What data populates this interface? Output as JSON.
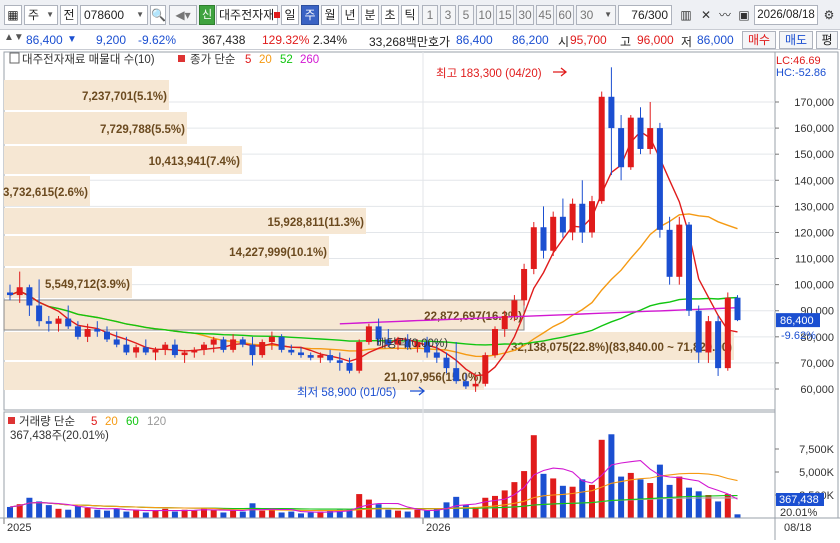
{
  "toolbar": {
    "market": "주",
    "prev_label": "전",
    "code": "078600",
    "sound_icon": "speaker-icon",
    "new_badge": "신",
    "stock_name": "대주전자재",
    "periods": [
      "일",
      "주",
      "월",
      "년",
      "분",
      "초",
      "틱"
    ],
    "selected_period": "주",
    "intervals": [
      "1",
      "3",
      "5",
      "10",
      "15",
      "30",
      "45",
      "60"
    ],
    "interval_value": "30",
    "count": "76",
    "count_total": "/300",
    "date": "2026/08/18"
  },
  "info": {
    "price": "86,400",
    "change": "9,200",
    "change_pct": "-9.62%",
    "volume": "367,438",
    "volume_pct": "129.32%",
    "turnover": "2.34%",
    "amount": "33,268백만",
    "quote_label": "호가",
    "ask": "86,400",
    "bid": "86,200",
    "open_label": "시",
    "open": "95,700",
    "high_label": "고",
    "high": "96,000",
    "low_label": "저",
    "low": "86,000",
    "buy": "매수",
    "sell": "매도",
    "flat": "평"
  },
  "legend": {
    "name": "대주전자재료 매물대 수(10)",
    "ma_label": "종가 단순",
    "ma": [
      "5",
      "20",
      "52",
      "260"
    ],
    "ma_colors": [
      "#e01b1b",
      "#f59a13",
      "#11c511",
      "#d218d2"
    ]
  },
  "volume_legend": {
    "label": "거래량 단순",
    "ma": [
      "5",
      "20",
      "60",
      "120"
    ],
    "value": "367,438주(20.01%)"
  },
  "chart_data": {
    "type": "candlestick",
    "y_axis": {
      "min": 50000,
      "max": 180000,
      "ticks": [
        "60,000",
        "70,000",
        "80,000",
        "90,000",
        "100,000",
        "110,000",
        "120,000",
        "130,000",
        "140,000",
        "150,000",
        "160,000",
        "170,000"
      ],
      "tick_values": [
        60000,
        70000,
        80000,
        90000,
        100000,
        110000,
        120000,
        130000,
        140000,
        150000,
        160000,
        170000
      ]
    },
    "current_price_tag": "86,400",
    "current_pct_tag": "-9.62%",
    "lc": "LC:46.69",
    "hc": "HC:-52.86",
    "x_labels": [
      "2025",
      "2026",
      "08/18"
    ],
    "high_annotation": "최고 183,300 (04/20)",
    "low_annotation": "최저 58,900 (01/05)",
    "volume_profile": [
      {
        "label": "7,237,701(5.1%)"
      },
      {
        "label": "7,729,788(5.5%)"
      },
      {
        "label": "10,413,941(7.4%)"
      },
      {
        "label": "3,732,615(2.6%)"
      },
      {
        "label": "15,928,811(11.3%)"
      },
      {
        "label": "14,227,999(10.1%)"
      },
      {
        "label": "5,549,712(3.9%)"
      },
      {
        "label": "22,872,697(16.2%)"
      },
      {
        "label": "32,138,075(22.8%)(83,840.00 ~ 71,820.00)"
      },
      {
        "label": "21,107,956(15.0%)"
      }
    ],
    "dividend_label": "배당락(0.00%)",
    "candles": [
      {
        "o": 97000,
        "h": 100000,
        "l": 94000,
        "c": 96000
      },
      {
        "o": 96000,
        "h": 105000,
        "l": 93000,
        "c": 99000
      },
      {
        "o": 99000,
        "h": 100000,
        "l": 88000,
        "c": 92000
      },
      {
        "o": 92000,
        "h": 102000,
        "l": 84000,
        "c": 86000
      },
      {
        "o": 86000,
        "h": 88000,
        "l": 82000,
        "c": 85000
      },
      {
        "o": 85000,
        "h": 88000,
        "l": 82000,
        "c": 87000
      },
      {
        "o": 87000,
        "h": 92000,
        "l": 83000,
        "c": 84000
      },
      {
        "o": 84000,
        "h": 86000,
        "l": 79000,
        "c": 80000
      },
      {
        "o": 80000,
        "h": 85000,
        "l": 78000,
        "c": 83000
      },
      {
        "o": 83000,
        "h": 86000,
        "l": 80000,
        "c": 82000
      },
      {
        "o": 82000,
        "h": 84000,
        "l": 78000,
        "c": 79000
      },
      {
        "o": 79000,
        "h": 82000,
        "l": 76000,
        "c": 77000
      },
      {
        "o": 77000,
        "h": 80000,
        "l": 73000,
        "c": 74000
      },
      {
        "o": 74000,
        "h": 77000,
        "l": 72000,
        "c": 76000
      },
      {
        "o": 76000,
        "h": 79000,
        "l": 73000,
        "c": 74000
      },
      {
        "o": 74000,
        "h": 76000,
        "l": 71000,
        "c": 75000
      },
      {
        "o": 75000,
        "h": 78000,
        "l": 73000,
        "c": 77000
      },
      {
        "o": 77000,
        "h": 79000,
        "l": 72000,
        "c": 73000
      },
      {
        "o": 73000,
        "h": 75000,
        "l": 70000,
        "c": 74000
      },
      {
        "o": 74000,
        "h": 76000,
        "l": 72000,
        "c": 75000
      },
      {
        "o": 75000,
        "h": 78000,
        "l": 73000,
        "c": 77000
      },
      {
        "o": 77000,
        "h": 80000,
        "l": 74000,
        "c": 79000
      },
      {
        "o": 79000,
        "h": 80000,
        "l": 74000,
        "c": 75000
      },
      {
        "o": 75000,
        "h": 81000,
        "l": 74000,
        "c": 79000
      },
      {
        "o": 79000,
        "h": 80000,
        "l": 76000,
        "c": 77000
      },
      {
        "o": 77000,
        "h": 80000,
        "l": 69000,
        "c": 73000
      },
      {
        "o": 73000,
        "h": 79000,
        "l": 72000,
        "c": 78000
      },
      {
        "o": 78000,
        "h": 82000,
        "l": 75000,
        "c": 80000
      },
      {
        "o": 80000,
        "h": 81000,
        "l": 74000,
        "c": 75000
      },
      {
        "o": 75000,
        "h": 77000,
        "l": 73000,
        "c": 74000
      },
      {
        "o": 74000,
        "h": 76000,
        "l": 72000,
        "c": 73000
      },
      {
        "o": 73000,
        "h": 74000,
        "l": 71000,
        "c": 72000
      },
      {
        "o": 72000,
        "h": 74000,
        "l": 70000,
        "c": 73000
      },
      {
        "o": 73000,
        "h": 75000,
        "l": 70000,
        "c": 71000
      },
      {
        "o": 71000,
        "h": 74000,
        "l": 67000,
        "c": 70000
      },
      {
        "o": 70000,
        "h": 72000,
        "l": 66000,
        "c": 67000
      },
      {
        "o": 67000,
        "h": 79000,
        "l": 66000,
        "c": 78000
      },
      {
        "o": 78000,
        "h": 85000,
        "l": 77000,
        "c": 84000
      },
      {
        "o": 84000,
        "h": 87000,
        "l": 77000,
        "c": 79000
      },
      {
        "o": 79000,
        "h": 83000,
        "l": 76000,
        "c": 77000
      },
      {
        "o": 77000,
        "h": 80000,
        "l": 75000,
        "c": 79000
      },
      {
        "o": 79000,
        "h": 81000,
        "l": 75000,
        "c": 76000
      },
      {
        "o": 76000,
        "h": 79000,
        "l": 74000,
        "c": 78000
      },
      {
        "o": 78000,
        "h": 80000,
        "l": 72000,
        "c": 74000
      },
      {
        "o": 74000,
        "h": 78000,
        "l": 70000,
        "c": 72000
      },
      {
        "o": 72000,
        "h": 74000,
        "l": 66000,
        "c": 68000
      },
      {
        "o": 68000,
        "h": 78000,
        "l": 62000,
        "c": 63000
      },
      {
        "o": 63000,
        "h": 66000,
        "l": 60000,
        "c": 61000
      },
      {
        "o": 61000,
        "h": 65000,
        "l": 58900,
        "c": 62000
      },
      {
        "o": 62000,
        "h": 74000,
        "l": 61000,
        "c": 73000
      },
      {
        "o": 73000,
        "h": 84000,
        "l": 72000,
        "c": 83000
      },
      {
        "o": 83000,
        "h": 90000,
        "l": 80000,
        "c": 88000
      },
      {
        "o": 88000,
        "h": 96000,
        "l": 86000,
        "c": 94000
      },
      {
        "o": 94000,
        "h": 108000,
        "l": 92000,
        "c": 106000
      },
      {
        "o": 106000,
        "h": 124000,
        "l": 104000,
        "c": 122000
      },
      {
        "o": 122000,
        "h": 130000,
        "l": 110000,
        "c": 113000
      },
      {
        "o": 113000,
        "h": 128000,
        "l": 111000,
        "c": 126000
      },
      {
        "o": 126000,
        "h": 133000,
        "l": 118000,
        "c": 120000
      },
      {
        "o": 120000,
        "h": 133000,
        "l": 117000,
        "c": 131000
      },
      {
        "o": 131000,
        "h": 140000,
        "l": 116000,
        "c": 120000
      },
      {
        "o": 120000,
        "h": 134000,
        "l": 118000,
        "c": 132000
      },
      {
        "o": 132000,
        "h": 174000,
        "l": 131000,
        "c": 172000
      },
      {
        "o": 172000,
        "h": 183300,
        "l": 142000,
        "c": 160000
      },
      {
        "o": 160000,
        "h": 165000,
        "l": 140000,
        "c": 145000
      },
      {
        "o": 145000,
        "h": 165000,
        "l": 144000,
        "c": 164000
      },
      {
        "o": 164000,
        "h": 168000,
        "l": 150000,
        "c": 152000
      },
      {
        "o": 152000,
        "h": 170000,
        "l": 150000,
        "c": 160000
      },
      {
        "o": 160000,
        "h": 162000,
        "l": 118000,
        "c": 121000
      },
      {
        "o": 121000,
        "h": 126000,
        "l": 100000,
        "c": 103000
      },
      {
        "o": 103000,
        "h": 126000,
        "l": 100000,
        "c": 123000
      },
      {
        "o": 123000,
        "h": 124000,
        "l": 88000,
        "c": 90000
      },
      {
        "o": 90000,
        "h": 92000,
        "l": 70000,
        "c": 74000
      },
      {
        "o": 74000,
        "h": 88000,
        "l": 70000,
        "c": 86000
      },
      {
        "o": 86000,
        "h": 88000,
        "l": 65000,
        "c": 68000
      },
      {
        "o": 68000,
        "h": 97000,
        "l": 67000,
        "c": 95000
      },
      {
        "o": 95000,
        "h": 96000,
        "l": 86000,
        "c": 86400
      }
    ],
    "volume_axis": {
      "ticks": [
        "2,500K",
        "5,000K",
        "7,500K"
      ],
      "tick_values": [
        2500,
        5000,
        7500
      ],
      "max": 10000,
      "current_tag": "367,438",
      "pct_tag": "20.01%"
    },
    "volumes": [
      1200,
      1500,
      2200,
      1800,
      1400,
      1000,
      900,
      1300,
      1100,
      900,
      800,
      1000,
      700,
      900,
      600,
      800,
      1000,
      700,
      900,
      800,
      1100,
      900,
      600,
      800,
      700,
      1600,
      800,
      900,
      600,
      700,
      500,
      600,
      700,
      800,
      900,
      900,
      2600,
      2000,
      1500,
      900,
      800,
      700,
      900,
      800,
      1000,
      1700,
      2300,
      1400,
      1200,
      2200,
      2400,
      3000,
      3900,
      5100,
      9000,
      4800,
      4300,
      3500,
      3400,
      4200,
      3600,
      8500,
      9100,
      4500,
      4900,
      4200,
      3800,
      5800,
      3600,
      4500,
      3300,
      2900,
      2500,
      1800,
      2600,
      400
    ]
  }
}
